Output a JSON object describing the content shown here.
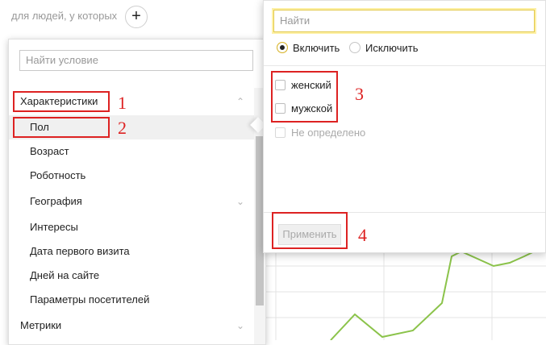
{
  "segment": {
    "prefix": "для людей, у которых",
    "add_label": "+"
  },
  "conditions": {
    "search_placeholder": "Найти условие",
    "rows": [
      {
        "label": "Характеристики",
        "kind": "group",
        "chevron": "chevron-up-icon"
      },
      {
        "label": "Пол",
        "kind": "item",
        "selected": true
      },
      {
        "label": "Возраст",
        "kind": "item"
      },
      {
        "label": "Роботность",
        "kind": "item"
      },
      {
        "label": "География",
        "kind": "item",
        "chevron": "chevron-down-icon"
      },
      {
        "label": "Интересы",
        "kind": "item"
      },
      {
        "label": "Дата первого визита",
        "kind": "item"
      },
      {
        "label": "Дней на сайте",
        "kind": "item"
      },
      {
        "label": "Параметры посетителей",
        "kind": "item"
      },
      {
        "label": "Метрики",
        "kind": "group",
        "chevron": "chevron-down-icon"
      }
    ]
  },
  "popup": {
    "search_placeholder": "Найти",
    "mode": {
      "include": "Включить",
      "exclude": "Исключить",
      "selected": "include"
    },
    "options": [
      {
        "label": "женский",
        "checked": false,
        "disabled": false
      },
      {
        "label": "мужской",
        "checked": false,
        "disabled": false
      },
      {
        "label": "Не определено",
        "checked": false,
        "disabled": true
      }
    ],
    "apply_label": "Применить"
  },
  "annotations": [
    "1",
    "2",
    "3",
    "4"
  ],
  "colors": {
    "annotation": "#dd2222",
    "chart_line": "#8bc34a",
    "grid": "#e3e3e3",
    "focus": "#fdf0a6"
  }
}
